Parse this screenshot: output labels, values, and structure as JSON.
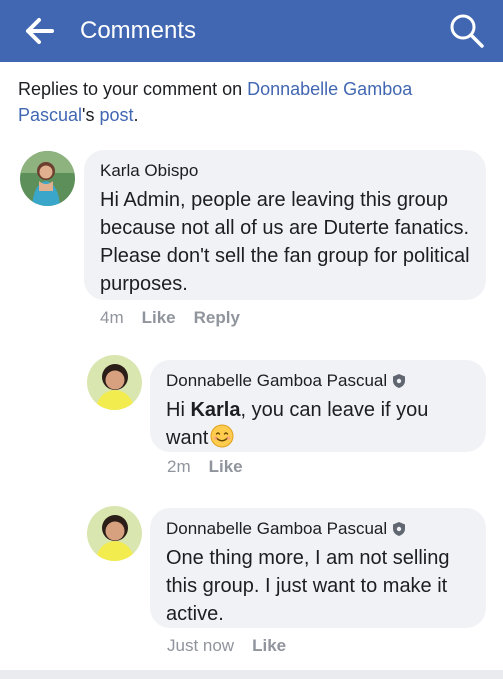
{
  "header": {
    "title": "Comments",
    "background": "#4267b2",
    "back_icon": "arrow-left-icon",
    "search_icon": "search-icon"
  },
  "context": {
    "prefix": "Replies to your comment on ",
    "author": "Donnabelle Gamboa Pascual",
    "possessive": "'s ",
    "post": "post",
    "period": "."
  },
  "comments": [
    {
      "author": "Karla Obispo",
      "text": "Hi Admin, people are leaving this group because not all of us are Duterte fanatics. Please don't sell the fan group for political purposes.",
      "time": "4m",
      "like": "Like",
      "reply": "Reply"
    },
    {
      "author": "Donnabelle Gamboa Pascual",
      "text_pre": "Hi ",
      "mention": "Karla",
      "text_post": ", you can leave if you want",
      "emoji": "smiling-face-emoji",
      "time": "2m",
      "like": "Like"
    },
    {
      "author": "Donnabelle Gamboa Pascual",
      "text": "One thing more, I am not selling this group. I just want to make it active.",
      "time": "Just now",
      "like": "Like"
    }
  ]
}
